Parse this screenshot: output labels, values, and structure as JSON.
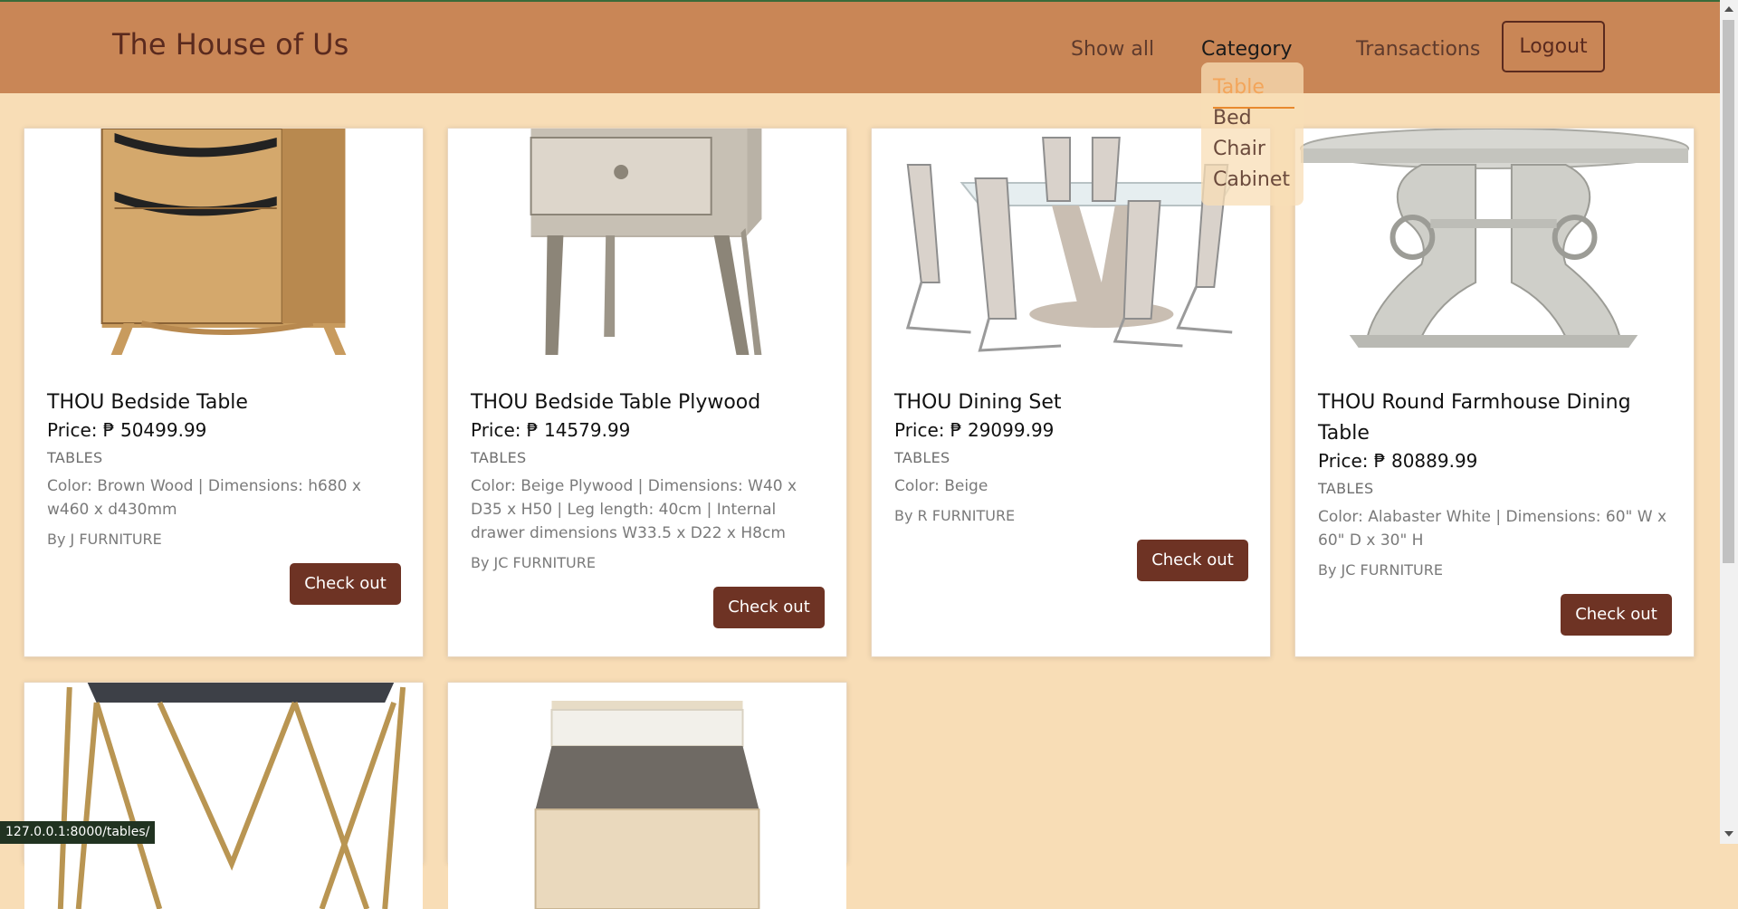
{
  "brand": "The House of Us",
  "nav": {
    "show_all": "Show all",
    "category": "Category",
    "transactions": "Transactions",
    "logout": "Logout"
  },
  "dropdown": {
    "items": [
      "Table",
      "Bed",
      "Chair",
      "Cabinet"
    ],
    "active": "Table"
  },
  "products": [
    {
      "title": "THOU Bedside Table",
      "price": "Price: ₱ 50499.99",
      "category": "TABLES",
      "description": "Color: Brown Wood | Dimensions: h680 x w460 x d430mm",
      "brand": "By J FURNITURE",
      "button": "Check out"
    },
    {
      "title": "THOU Bedside Table Plywood",
      "price": "Price: ₱ 14579.99",
      "category": "TABLES",
      "description": "Color: Beige Plywood | Dimensions: W40 x D35 x H50 | Leg length: 40cm | Internal drawer dimensions W33.5 x D22 x H8cm",
      "brand": "By JC FURNITURE",
      "button": "Check out"
    },
    {
      "title": "THOU Dining Set",
      "price": "Price: ₱ 29099.99",
      "category": "TABLES",
      "description": "Color: Beige",
      "brand": "By R FURNITURE",
      "button": "Check out"
    },
    {
      "title": "THOU Round Farmhouse Dining Table",
      "price": "Price: ₱ 80889.99",
      "category": "TABLES",
      "description": "Color: Alabaster White | Dimensions: 60\" W x 60\" D x 30\" H",
      "brand": "By JC FURNITURE",
      "button": "Check out"
    }
  ],
  "status_url": "127.0.0.1:8000/tables/"
}
